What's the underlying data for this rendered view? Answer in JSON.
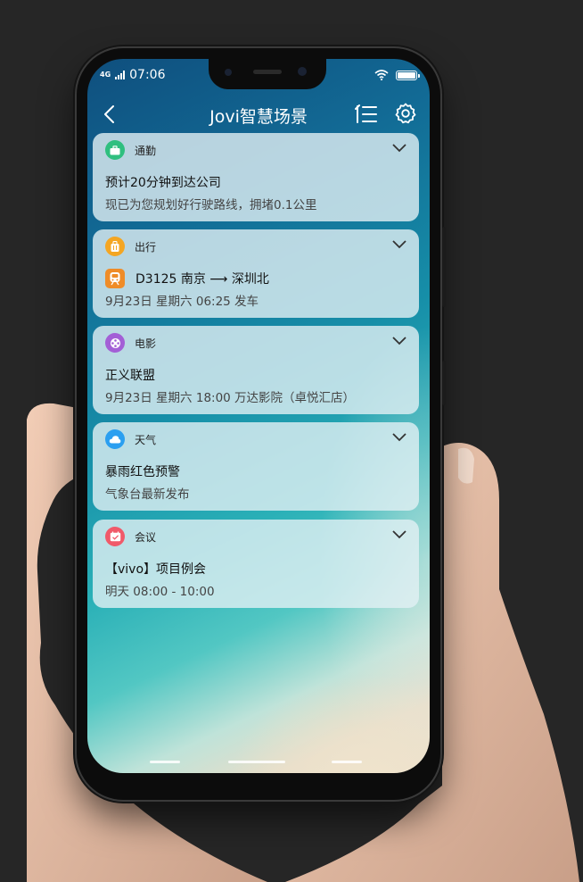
{
  "status_bar": {
    "network": "4G",
    "time": "07:06"
  },
  "app_bar": {
    "title": "Jovi智慧场景"
  },
  "cards": [
    {
      "category": "通勤",
      "line1": "预计20分钟到达公司",
      "line2": "现已为您规划好行驶路线，拥堵0.1公里",
      "icon": "briefcase-icon",
      "color": "#2fbf7f"
    },
    {
      "category": "出行",
      "line1": "D3125 南京 ⟶ 深圳北",
      "line2": "9月23日 星期六 06:25 发车",
      "icon": "luggage-icon",
      "color": "#f4a623"
    },
    {
      "category": "电影",
      "line1": "正义联盟",
      "line2": "9月23日 星期六 18:00  万达影院（卓悦汇店）",
      "icon": "film-reel-icon",
      "color": "#a35fd6"
    },
    {
      "category": "天气",
      "line1": "暴雨红色预警",
      "line2": "气象台最新发布",
      "icon": "cloud-icon",
      "color": "#2b9ff0"
    },
    {
      "category": "会议",
      "line1": "【vivo】项目例会",
      "line2": "明天 08:00 - 10:00",
      "icon": "calendar-icon",
      "color": "#f05a6a"
    }
  ]
}
